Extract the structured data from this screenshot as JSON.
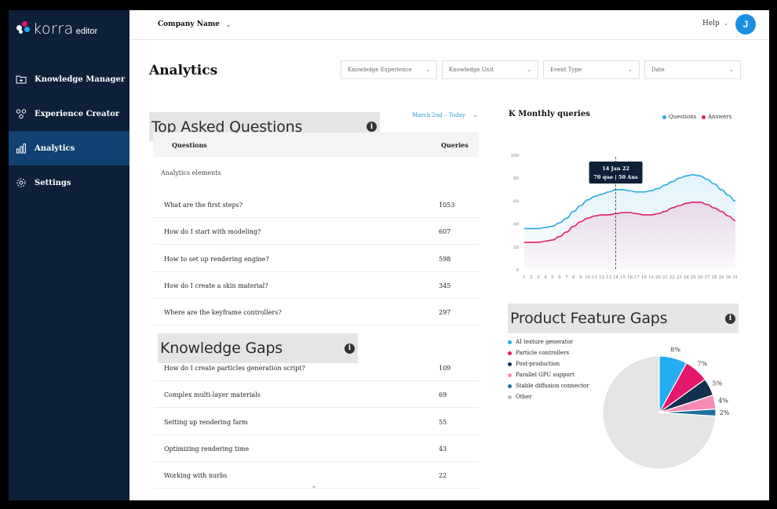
{
  "app": {
    "logo_text": "korra",
    "logo_sub": "editor"
  },
  "sidebar": {
    "items": [
      {
        "label": "Knowledge Manager",
        "icon": "folder-plus-icon",
        "active": false
      },
      {
        "label": "Experience Creator",
        "icon": "nodes-icon",
        "active": false
      },
      {
        "label": "Analytics",
        "icon": "bar-chart-icon",
        "active": true
      },
      {
        "label": "Settings",
        "icon": "gear-icon",
        "active": false
      }
    ]
  },
  "header": {
    "company": "Company Name",
    "help": "Help",
    "avatar_initial": "J"
  },
  "page": {
    "title": "Analytics"
  },
  "filters": [
    {
      "placeholder": "Knowledge Experience"
    },
    {
      "placeholder": "Knowledge Unit"
    },
    {
      "placeholder": "Event Type"
    },
    {
      "placeholder": "Date"
    }
  ],
  "top_questions": {
    "title": "Top Asked Questions",
    "date_range": "March 2nd – Today",
    "columns": [
      "Questions",
      "Queries"
    ],
    "group_label": "Analytics elements",
    "rows": [
      {
        "q": "What are the first steps?",
        "n": "1053"
      },
      {
        "q": "How do I start with modeling?",
        "n": "607"
      },
      {
        "q": "How to set up rendering engine?",
        "n": "598"
      },
      {
        "q": "How do I create a skin material?",
        "n": "345"
      },
      {
        "q": "Where are the keyframe controllers?",
        "n": "297"
      }
    ]
  },
  "knowledge_gaps": {
    "title": "Knowledge Gaps",
    "rows": [
      {
        "q": "How do I create particles generation script?",
        "n": "109"
      },
      {
        "q": "Complex multi-layer materials",
        "n": "69"
      },
      {
        "q": "Setting up rendering farm",
        "n": "55"
      },
      {
        "q": "Optimizing rendering time",
        "n": "43"
      },
      {
        "q": "Working with nurbs",
        "n": "22"
      }
    ]
  },
  "monthly_queries": {
    "title": "K Monthly queries",
    "legend": [
      "Questions",
      "Answers"
    ],
    "tooltip": {
      "date": "14 Jan 22",
      "value": "70 que | 50 Ans"
    },
    "colors": {
      "questions": "#2aa9e0",
      "answers": "#e0206b"
    }
  },
  "product_gaps": {
    "title": "Product Feature Gaps",
    "legend": [
      {
        "label": "AI texture generator",
        "color": "#23aef0"
      },
      {
        "label": "Particle controllers",
        "color": "#e5176b"
      },
      {
        "label": "Post-production",
        "color": "#14304f"
      },
      {
        "label": "Parallel GPU support",
        "color": "#f58bb4"
      },
      {
        "label": "Stable diffusion connector",
        "color": "#1f6f9c"
      },
      {
        "label": "Other",
        "color": "#bdbdbd"
      }
    ]
  },
  "chart_data": [
    {
      "type": "line",
      "title": "K Monthly queries",
      "x": [
        1,
        2,
        3,
        4,
        5,
        6,
        7,
        8,
        9,
        10,
        11,
        12,
        13,
        14,
        15,
        16,
        17,
        18,
        19,
        20,
        21,
        22,
        23,
        24,
        25,
        26,
        27,
        28,
        29,
        30,
        31
      ],
      "ylim": [
        0,
        100
      ],
      "yticks": [
        0,
        20,
        40,
        60,
        80,
        100
      ],
      "grid": false,
      "legend_position": "top-right",
      "series": [
        {
          "name": "Questions",
          "values": [
            36,
            36,
            36,
            37,
            38,
            41,
            45,
            51,
            56,
            61,
            64,
            66,
            68,
            70,
            70,
            69,
            68,
            68,
            69,
            71,
            74,
            77,
            80,
            82,
            83,
            82,
            79,
            75,
            70,
            65,
            60
          ]
        },
        {
          "name": "Answers",
          "values": [
            24,
            24,
            24,
            25,
            26,
            29,
            33,
            38,
            42,
            45,
            47,
            48,
            48,
            49,
            50,
            50,
            49,
            48,
            48,
            49,
            51,
            54,
            56,
            58,
            59,
            59,
            57,
            54,
            51,
            47,
            43
          ]
        }
      ],
      "annotation": {
        "x": 14,
        "text": "14 Jan 22",
        "value": "70 que | 50 Ans"
      }
    },
    {
      "type": "pie",
      "title": "Product Feature Gaps",
      "categories": [
        "AI texture generator",
        "Particle controllers",
        "Post-production",
        "Parallel GPU support",
        "Stable diffusion connector",
        "Other"
      ],
      "values": [
        8,
        7,
        5,
        4,
        2,
        74
      ],
      "labels": [
        "8%",
        "7%",
        "5%",
        "4%",
        "2%",
        ""
      ]
    }
  ]
}
